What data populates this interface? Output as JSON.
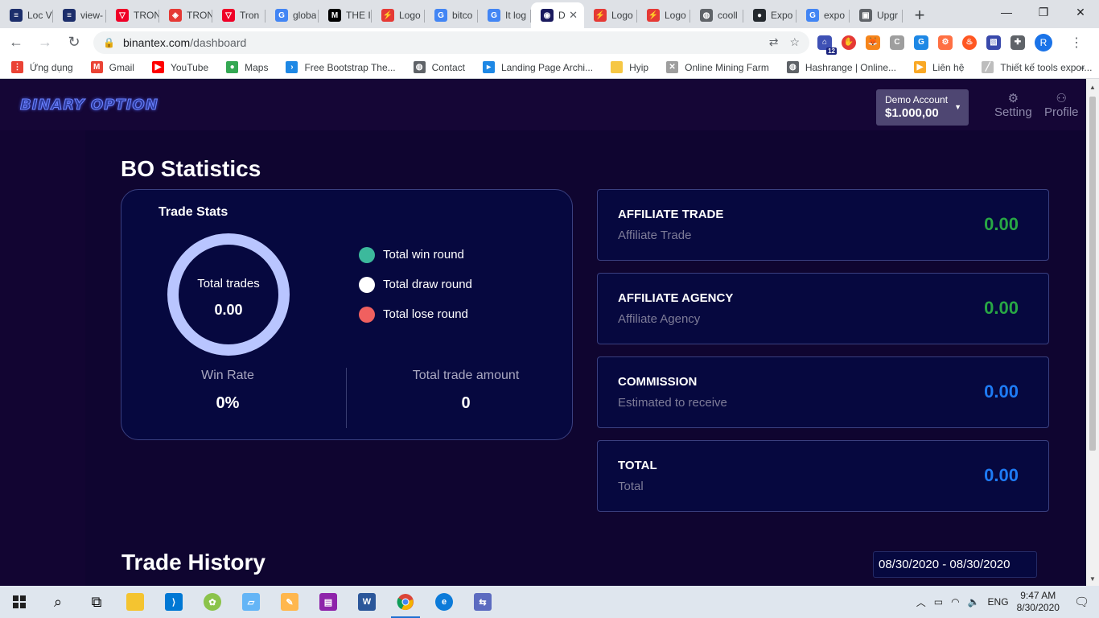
{
  "browser": {
    "tabs": [
      {
        "title": "Loc V",
        "fav_color": "#1c2e6b",
        "fav_glyph": "≡"
      },
      {
        "title": "view-",
        "fav_color": "#1c2e6b",
        "fav_glyph": "≡"
      },
      {
        "title": "TRON",
        "fav_color": "#ef0027",
        "fav_glyph": "▽"
      },
      {
        "title": "TRON",
        "fav_color": "#e53935",
        "fav_glyph": "◈"
      },
      {
        "title": "Tron",
        "fav_color": "#ef0027",
        "fav_glyph": "▽"
      },
      {
        "title": "globa",
        "fav_color": "#4285f4",
        "fav_glyph": "G"
      },
      {
        "title": "THE I",
        "fav_color": "#000000",
        "fav_glyph": "M"
      },
      {
        "title": "Logo",
        "fav_color": "#e53935",
        "fav_glyph": "⚡"
      },
      {
        "title": "bitco",
        "fav_color": "#4285f4",
        "fav_glyph": "G"
      },
      {
        "title": "It log",
        "fav_color": "#4285f4",
        "fav_glyph": "G"
      },
      {
        "title": "D",
        "fav_color": "#1a1a5e",
        "fav_glyph": "◉",
        "active": true
      },
      {
        "title": "Logo",
        "fav_color": "#e53935",
        "fav_glyph": "⚡"
      },
      {
        "title": "Logo",
        "fav_color": "#e53935",
        "fav_glyph": "⚡"
      },
      {
        "title": "cooll",
        "fav_color": "#5f6368",
        "fav_glyph": "◍"
      },
      {
        "title": "Expo",
        "fav_color": "#24292e",
        "fav_glyph": "●"
      },
      {
        "title": "expo",
        "fav_color": "#4285f4",
        "fav_glyph": "G"
      },
      {
        "title": "Upgr",
        "fav_color": "#5f6368",
        "fav_glyph": "▣"
      }
    ],
    "new_tab_label": "+",
    "url_host": "binantex.com",
    "url_path": "/dashboard",
    "avatar_letter": "R",
    "extension_badge": "12",
    "bookmarks": [
      {
        "label": "Ứng dụng",
        "icon": "apps-grid-icon",
        "color": "#ea4335",
        "glyph": "⋮"
      },
      {
        "label": "Gmail",
        "icon": "gmail-icon",
        "color": "#ea4335",
        "glyph": "M"
      },
      {
        "label": "YouTube",
        "icon": "youtube-icon",
        "color": "#ff0000",
        "glyph": "▶"
      },
      {
        "label": "Maps",
        "icon": "maps-icon",
        "color": "#34a853",
        "glyph": "●"
      },
      {
        "label": "Free Bootstrap The...",
        "icon": "bootstrap-icon",
        "color": "#1e88e5",
        "glyph": "›"
      },
      {
        "label": "Contact",
        "icon": "globe-icon",
        "color": "#5f6368",
        "glyph": "◍"
      },
      {
        "label": "Landing Page Archi...",
        "icon": "landing-icon",
        "color": "#1e88e5",
        "glyph": "▸"
      },
      {
        "label": "Hyip",
        "icon": "folder-icon",
        "color": "#f6c744",
        "glyph": ""
      },
      {
        "label": "Online Mining Farm",
        "icon": "mining-icon",
        "color": "#9e9e9e",
        "glyph": "✕"
      },
      {
        "label": "Hashrange | Online...",
        "icon": "globe-icon",
        "color": "#5f6368",
        "glyph": "◍"
      },
      {
        "label": "Liên hệ",
        "icon": "contact-icon",
        "color": "#f9a825",
        "glyph": "▶"
      },
      {
        "label": "Thiết kế tools expor...",
        "icon": "tools-icon",
        "color": "#bdbdbd",
        "glyph": "╱"
      }
    ],
    "bookmarks_more": "»"
  },
  "header": {
    "logo_text": "BINARY OPTION",
    "account_label": "Demo Account",
    "account_balance": "$1.000,00",
    "setting_label": "Setting",
    "profile_label": "Profile"
  },
  "stats": {
    "section_title": "BO Statistics",
    "card_title": "Trade Stats",
    "donut_label": "Total trades",
    "donut_value": "0.00",
    "legend": [
      {
        "label": "Total win round",
        "color": "#3cb99c"
      },
      {
        "label": "Total draw round",
        "color": "#ffffff"
      },
      {
        "label": "Total lose round",
        "color": "#f0605f"
      }
    ],
    "win_rate_label": "Win Rate",
    "win_rate_value": "0%",
    "trade_amount_label": "Total trade amount",
    "trade_amount_value": "0"
  },
  "affiliate": [
    {
      "title": "AFFILIATE TRADE",
      "subtitle": "Affiliate Trade",
      "value": "0.00",
      "color": "#28a745"
    },
    {
      "title": "AFFILIATE AGENCY",
      "subtitle": "Affiliate Agency",
      "value": "0.00",
      "color": "#28a745"
    },
    {
      "title": "COMMISSION",
      "subtitle": "Estimated to receive",
      "value": "0.00",
      "color": "#1e7bf5"
    },
    {
      "title": "TOTAL",
      "subtitle": "Total",
      "value": "0.00",
      "color": "#1e7bf5"
    }
  ],
  "history": {
    "section_title": "Trade History",
    "date_range": "08/30/2020 - 08/30/2020"
  },
  "taskbar": {
    "language": "ENG",
    "time": "9:47 AM",
    "date": "8/30/2020"
  }
}
